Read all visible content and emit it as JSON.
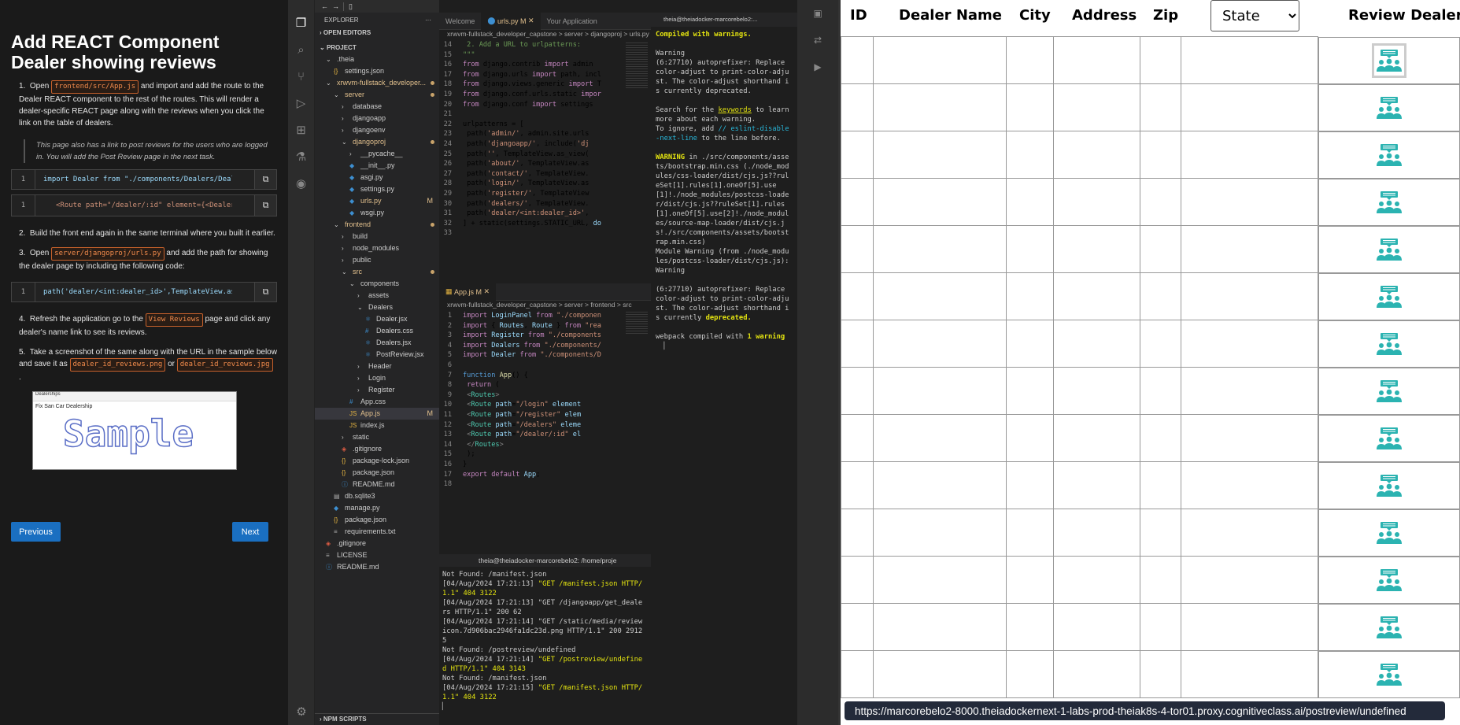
{
  "instructions": {
    "title": "Add REACT Component Dealer showing reviews",
    "step1": {
      "pre": "Open",
      "file": "frontend/src/App.js",
      "post": "and import and add the route to the Dealer REACT component to the rest of the routes. This will render a dealer-specific REACT page along with the reviews when you click the link on the table of dealers."
    },
    "note": "This page also has a link to post reviews for the users who are logged in. You will add the Post Review page in the next task.",
    "code1": {
      "line": "1",
      "text": "import Dealer from \"./components/Dealers/Dealer\""
    },
    "code2": {
      "line": "1",
      "text": "<Route path=\"/dealer/:id\" element={<Dealer/>}"
    },
    "step2": "Build the front end again in the same terminal where you built it earlier.",
    "step3": {
      "pre": "Open",
      "file": "server/djangoproj/urls.py",
      "post": "and add the path for showing the dealer page by including the following code:"
    },
    "code3": {
      "line": "1",
      "text": "path('dealer/<int:dealer_id>',TemplateView.as_view"
    },
    "step4": {
      "pre": "Refresh the application go to the",
      "tag": "View Reviews",
      "post": "page and click any dealer's name link to see its reviews."
    },
    "step5": {
      "pre": "Take a screenshot of the same along with the URL in the sample below and save it as",
      "file1": "dealer_id_reviews.png",
      "or": "or",
      "file2": "dealer_id_reviews.jpg"
    },
    "sample": {
      "watermark": "Sample",
      "site": "Dealerships",
      "heading": "Fix San Car Dealership"
    },
    "prev_label": "Previous",
    "next_label": "Next"
  },
  "explorer": {
    "header": "EXPLORER",
    "open_editors": "OPEN EDITORS",
    "project": "PROJECT",
    "npm": "NPM SCRIPTS",
    "items": [
      {
        "label": ".theia",
        "indent": 1,
        "icon": "chevron-down",
        "color": "#ccc"
      },
      {
        "label": "settings.json",
        "indent": 2,
        "icon": "json",
        "color": "#ccc"
      },
      {
        "label": "xrwvm-fullstack_developer...",
        "indent": 1,
        "icon": "chevron-down",
        "color": "#e2c08d",
        "dot": true
      },
      {
        "label": "server",
        "indent": 2,
        "icon": "chevron-down",
        "color": "#e2c08d",
        "dot": true
      },
      {
        "label": "database",
        "indent": 3,
        "icon": "chevron-right",
        "color": "#ccc"
      },
      {
        "label": "djangoapp",
        "indent": 3,
        "icon": "chevron-right",
        "color": "#ccc"
      },
      {
        "label": "djangoenv",
        "indent": 3,
        "icon": "chevron-right",
        "color": "#ccc"
      },
      {
        "label": "djangoproj",
        "indent": 3,
        "icon": "chevron-down",
        "color": "#e2c08d",
        "dot": true
      },
      {
        "label": "__pycache__",
        "indent": 4,
        "icon": "chevron-right",
        "color": "#ccc"
      },
      {
        "label": "__init__.py",
        "indent": 4,
        "icon": "py",
        "color": "#ccc"
      },
      {
        "label": "asgi.py",
        "indent": 4,
        "icon": "py",
        "color": "#ccc"
      },
      {
        "label": "settings.py",
        "indent": 4,
        "icon": "py",
        "color": "#ccc"
      },
      {
        "label": "urls.py",
        "indent": 4,
        "icon": "py",
        "color": "#e2c08d",
        "mod": "M"
      },
      {
        "label": "wsgi.py",
        "indent": 4,
        "icon": "py",
        "color": "#ccc"
      },
      {
        "label": "frontend",
        "indent": 2,
        "icon": "chevron-down",
        "color": "#e2c08d",
        "dot": true
      },
      {
        "label": "build",
        "indent": 3,
        "icon": "chevron-right",
        "color": "#ccc"
      },
      {
        "label": "node_modules",
        "indent": 3,
        "icon": "chevron-right",
        "color": "#ccc"
      },
      {
        "label": "public",
        "indent": 3,
        "icon": "chevron-right",
        "color": "#ccc"
      },
      {
        "label": "src",
        "indent": 3,
        "icon": "chevron-down",
        "color": "#e2c08d",
        "dot": true
      },
      {
        "label": "components",
        "indent": 4,
        "icon": "chevron-down",
        "color": "#ccc"
      },
      {
        "label": "assets",
        "indent": 5,
        "icon": "chevron-right",
        "color": "#ccc"
      },
      {
        "label": "Dealers",
        "indent": 5,
        "icon": "chevron-down",
        "color": "#ccc"
      },
      {
        "label": "Dealer.jsx",
        "indent": 6,
        "icon": "jsx",
        "color": "#ccc"
      },
      {
        "label": "Dealers.css",
        "indent": 6,
        "icon": "css",
        "color": "#ccc"
      },
      {
        "label": "Dealers.jsx",
        "indent": 6,
        "icon": "jsx",
        "color": "#ccc"
      },
      {
        "label": "PostReview.jsx",
        "indent": 6,
        "icon": "jsx",
        "color": "#ccc"
      },
      {
        "label": "Header",
        "indent": 5,
        "icon": "chevron-right",
        "color": "#ccc"
      },
      {
        "label": "Login",
        "indent": 5,
        "icon": "chevron-right",
        "color": "#ccc"
      },
      {
        "label": "Register",
        "indent": 5,
        "icon": "chevron-right",
        "color": "#ccc"
      },
      {
        "label": "App.css",
        "indent": 4,
        "icon": "css",
        "color": "#ccc"
      },
      {
        "label": "App.js",
        "indent": 4,
        "icon": "js",
        "color": "#e2c08d",
        "mod": "M",
        "selected": true
      },
      {
        "label": "index.js",
        "indent": 4,
        "icon": "js",
        "color": "#ccc"
      },
      {
        "label": "static",
        "indent": 3,
        "icon": "chevron-right",
        "color": "#ccc"
      },
      {
        "label": ".gitignore",
        "indent": 3,
        "icon": "git",
        "color": "#ccc"
      },
      {
        "label": "package-lock.json",
        "indent": 3,
        "icon": "json",
        "color": "#ccc"
      },
      {
        "label": "package.json",
        "indent": 3,
        "icon": "json",
        "color": "#ccc"
      },
      {
        "label": "README.md",
        "indent": 3,
        "icon": "md",
        "color": "#ccc"
      },
      {
        "label": "db.sqlite3",
        "indent": 2,
        "icon": "db",
        "color": "#ccc"
      },
      {
        "label": "manage.py",
        "indent": 2,
        "icon": "py",
        "color": "#ccc"
      },
      {
        "label": "package.json",
        "indent": 2,
        "icon": "json",
        "color": "#ccc"
      },
      {
        "label": "requirements.txt",
        "indent": 2,
        "icon": "txt",
        "color": "#ccc"
      },
      {
        "label": ".gitignore",
        "indent": 1,
        "icon": "git",
        "color": "#ccc"
      },
      {
        "label": "LICENSE",
        "indent": 1,
        "icon": "txt",
        "color": "#ccc"
      },
      {
        "label": "README.md",
        "indent": 1,
        "icon": "md",
        "color": "#ccc"
      }
    ]
  },
  "editor_top": {
    "tabs": [
      "Welcome",
      "urls.py M",
      "Your Application"
    ],
    "breadcrumb": "xrwvm-fullstack_developer_capstone > server > djangoproj > urls.py",
    "first_line": "14",
    "lines": [
      "<span class='c'>    2. Add a URL to urlpatterns:</span>",
      "<span class='c'>\"\"\"</span>",
      "<span class='k'>from</span> django.contrib <span class='k'>import</span> admin",
      "<span class='k'>from</span> django.urls <span class='k'>import</span> path, incl",
      "<span class='k'>from</span> django.views.generic <span class='k'>import</span> T",
      "<span class='k'>from</span> django.conf.urls.static <span class='k'>impor</span>",
      "<span class='k'>from</span> django.conf <span class='k'>import</span> settings",
      "",
      "urlpatterns = [",
      "    path(<span class='s'>'admin/'</span>, admin.site.urls",
      "    path(<span class='s'>'djangoapp/'</span>, include(<span class='s'>'dj</span>",
      "    path(<span class='s'>''</span>, TemplateView.as_view(",
      "    path(<span class='s'>'about/'</span>, TemplateView.as",
      "    path(<span class='s'>'contact/'</span>, TemplateView.",
      "    path(<span class='s'>'login/'</span>, TemplateView.as",
      "    path(<span class='s'>'register/'</span>, TemplateView",
      "    path(<span class='s'>'dealers/'</span>, TemplateView.",
      "    path(<span class='s'>'dealer/&lt;int:dealer_id&gt;'</span>,",
      "] + static(settings.STATIC_URL, <span class='v'>do</span>",
      ""
    ]
  },
  "editor_bottom": {
    "tab": "App.js M",
    "breadcrumb": "xrwvm-fullstack_developer_capstone > server > frontend > src",
    "lines": [
      "<span class='k'>import</span> <span class='v'>LoginPanel</span> <span class='k'>from</span> <span class='s'>\"./componen</span>",
      "<span class='k'>import</span> { <span class='v'>Routes</span>, <span class='v'>Route</span> } <span class='k'>from</span> <span class='s'>\"rea</span>",
      "<span class='k'>import</span> <span class='v'>Register</span> <span class='k'>from</span> <span class='s'>\"./components</span>",
      "<span class='k'>import</span> <span class='v'>Dealers</span> <span class='k'>from</span> <span class='s'>\"./components/</span>",
      "<span class='k'>import</span> <span class='v'>Dealer</span> <span class='k'>from</span> <span class='s'>\"./components/D</span>",
      "",
      "<span class='b'>function</span> <span class='f'>App</span>() {",
      "  <span class='k'>return</span> (",
      "    <span class='g'>&lt;</span><span class='t'>Routes</span><span class='g'>&gt;</span>",
      "      <span class='g'>&lt;</span><span class='t'>Route</span> <span class='v'>path</span>=<span class='s'>\"/login\"</span> <span class='v'>element</span>",
      "      <span class='g'>&lt;</span><span class='t'>Route</span> <span class='v'>path</span>=<span class='s'>\"/register\"</span> <span class='v'>elem</span>",
      "      <span class='g'>&lt;</span><span class='t'>Route</span> <span class='v'>path</span>=<span class='s'>\"/dealers\"</span> <span class='v'>eleme</span>",
      "      <span class='g'>&lt;</span><span class='t'>Route</span> <span class='v'>path</span>=<span class='s'>\"/dealer/:id\"</span> <span class='v'>el</span>",
      "    <span class='g'>&lt;/</span><span class='t'>Routes</span><span class='g'>&gt;</span>",
      "  );",
      "}",
      "<span class='k'>export</span> <span class='k'>default</span> <span class='v'>App</span>;",
      ""
    ]
  },
  "terminal_right": {
    "title": "theia@theiadocker-marcorebelo2:...",
    "text": "<span style='color:#e5e510;font-weight:bold'>Compiled with warnings.</span>\n\nWarning\n(6:27710) autoprefixer: Replace color-adjust to print-color-adjust. The color-adjust shorthand is currently deprecated.\n\nSearch for the <span style='color:#e5e510;text-decoration:underline'>keywords</span> to learn more about each warning.\nTo ignore, add <span style='color:#29b8db'>// eslint-disable-next-line</span> to the line before.\n\n<span style='color:#e5e510;font-weight:bold'>WARNING</span> in ./src/components/assets/bootstrap.min.css (./node_modules/css-loader/dist/cjs.js??ruleSet[1].rules[1].oneOf[5].use[1]!./node_modules/postcss-loader/dist/cjs.js??ruleSet[1].rules[1].oneOf[5].use[2]!./node_modules/source-map-loader/dist/cjs.js!./src/components/assets/bootstrap.min.css)\nModule Warning (from ./node_modules/postcss-loader/dist/cjs.js):\nWarning\n\n(6:27710) autoprefixer: Replace color-adjust to print-color-adjust. The color-adjust shorthand is currently <span style='color:#e5e510;font-weight:bold'>deprecated.</span>\n\nwebpack compiled with <span style='color:#e5e510;font-weight:bold'>1 warning</span>\n  ▏"
  },
  "terminal_bottom": {
    "title": "theia@theiadocker-marcorebelo2: /home/proje",
    "text": "Not Found: /manifest.json\n[04/Aug/2024 17:21:13] <span style='color:#e5e510'>\"GET /manifest.json HTTP/1.1\" 404 3122</span>\n[04/Aug/2024 17:21:13] \"GET /djangoapp/get_dealers HTTP/1.1\" 200 62\n[04/Aug/2024 17:21:14] \"GET /static/media/reviewicon.7d906bac2946fa1dc23d.png HTTP/1.1\" 200 29125\nNot Found: /postreview/undefined\n[04/Aug/2024 17:21:14] <span style='color:#e5e510'>\"GET /postreview/undefined HTTP/1.1\" 404 3143</span>\nNot Found: /manifest.json\n[04/Aug/2024 17:21:15] <span style='color:#e5e510'>\"GET /manifest.json HTTP/1.1\" 404 3122</span>\n▏"
  },
  "browser": {
    "headers": {
      "id": "ID",
      "name": "Dealer Name",
      "city": "City",
      "address": "Address",
      "zip": "Zip",
      "review": "Review Dealer"
    },
    "state_select": "State",
    "row_count": 14,
    "url": "https://marcorebelo2-8000.theiadockernext-1-labs-prod-theiak8s-4-tor01.proxy.cognitiveclass.ai/postreview/undefined",
    "icon_color": "#2bb3b1"
  }
}
